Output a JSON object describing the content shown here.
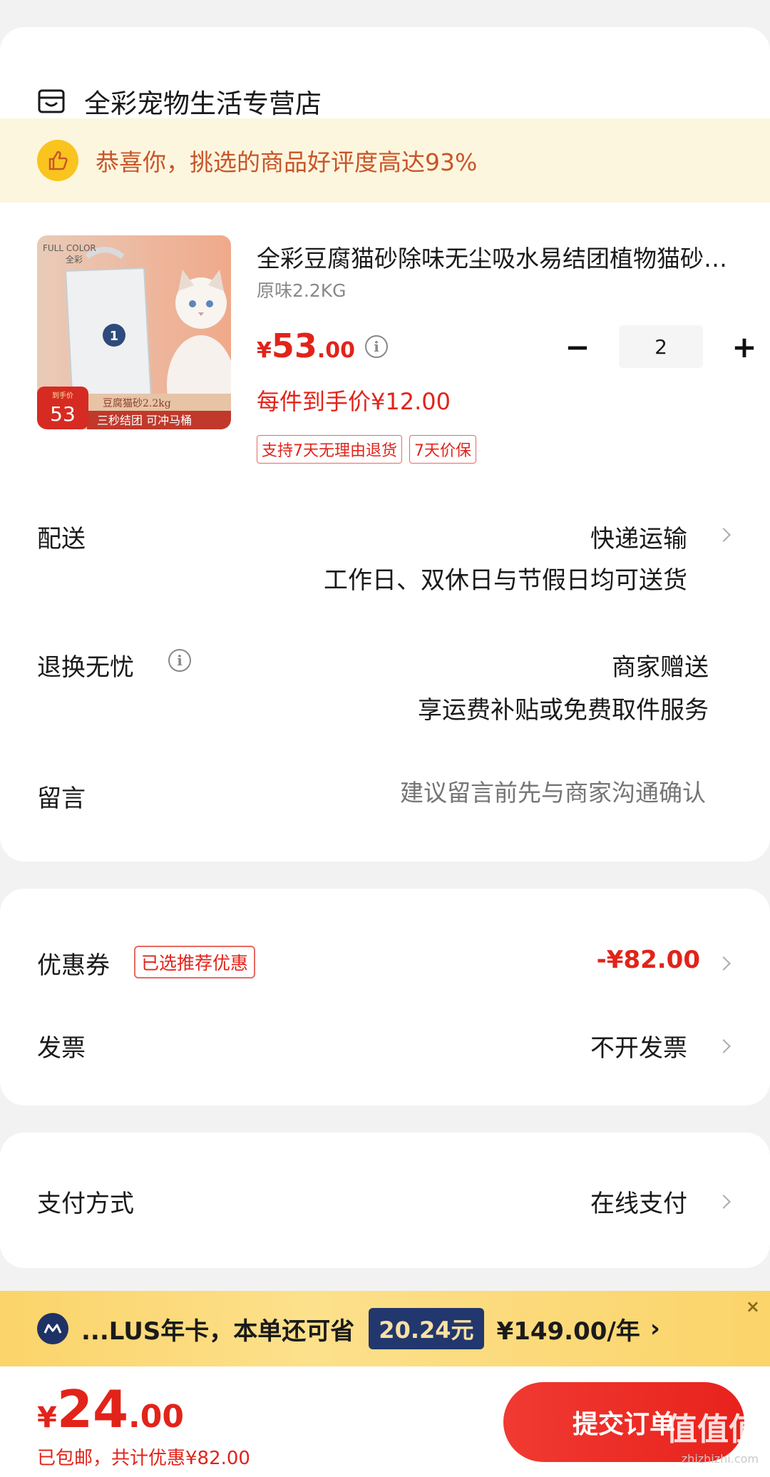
{
  "store": {
    "name": "全彩宠物生活专营店",
    "icon": "store-icon"
  },
  "banner": {
    "text": "恭喜你，挑选的商品好评度高达93%",
    "icon": "thumbs-up-icon"
  },
  "product": {
    "title": "全彩豆腐猫砂除味无尘吸水易结团植物猫砂豆腐砂",
    "spec": "原味2.2KG",
    "price_currency": "¥",
    "price_int": "53",
    "price_dec": ".00",
    "per_price": "每件到手价¥12.00",
    "tags": [
      "支持7天无理由退货",
      "7天价保"
    ],
    "quantity": "2",
    "image": {
      "brand": "FULL COLOR",
      "brand_cn": "全彩",
      "badge_small": "到手价",
      "badge_price": "53",
      "caption1": "豆腐猫砂2.2kg",
      "caption2": "三秒结团  可冲马桶"
    }
  },
  "delivery": {
    "label": "配送",
    "method": "快递运输",
    "desc": "工作日、双休日与节假日均可送货"
  },
  "returns": {
    "label": "退换无忧",
    "value": "商家赠送",
    "desc": "享运费补贴或免费取件服务"
  },
  "message": {
    "label": "留言",
    "placeholder": "建议留言前先与商家沟通确认"
  },
  "coupon": {
    "label": "优惠券",
    "badge": "已选推荐优惠",
    "value": "-¥82.00"
  },
  "invoice": {
    "label": "发票",
    "value": "不开发票"
  },
  "payment": {
    "label": "支付方式",
    "value": "在线支付"
  },
  "vip": {
    "text": "...LUS年卡，本单还可省",
    "save": "20.24元",
    "price": "¥149.00/年",
    "arrow": "›",
    "close": "×"
  },
  "bottom": {
    "currency": "¥",
    "total_int": "24",
    "total_dec": ".00",
    "sub": "已包邮，共计优惠¥82.00",
    "submit": "提交订单",
    "watermark": "值值值",
    "watermark_sub": "zhizhizhi.com"
  },
  "colors": {
    "accent": "#e2231a",
    "banner_bg": "#fdf6de",
    "vip_bg": "#fbd46a",
    "vip_badge": "#22376e"
  }
}
